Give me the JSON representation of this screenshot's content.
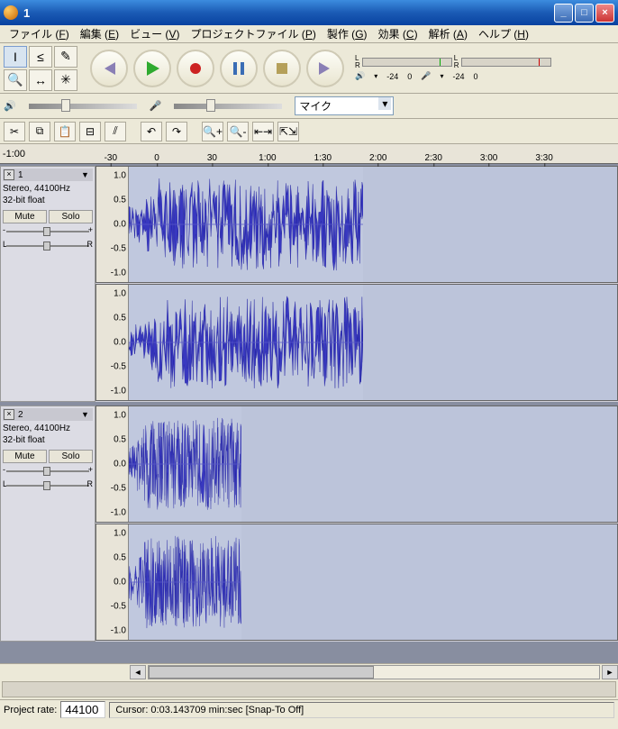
{
  "window": {
    "title": "1"
  },
  "menu": {
    "file": "ファイル",
    "file_key": "F",
    "edit": "編集",
    "edit_key": "E",
    "view": "ビュー",
    "view_key": "V",
    "project": "プロジェクトファイル",
    "project_key": "P",
    "generate": "製作",
    "generate_key": "G",
    "effect": "効果",
    "effect_key": "C",
    "analyze": "解析",
    "analyze_key": "A",
    "help": "ヘルプ",
    "help_key": "H"
  },
  "meters": {
    "left_label": "L",
    "right_label": "R",
    "ticks": [
      "-24",
      "0"
    ]
  },
  "toolbar2": {
    "input_device": "マイク"
  },
  "ruler": {
    "ticks": [
      "-1:00",
      "-30",
      "0",
      "30",
      "1:00",
      "1:30",
      "2:00",
      "2:30",
      "3:00",
      "3:30"
    ]
  },
  "tracks": {
    "t1": {
      "name": "1",
      "info1": "Stereo, 44100Hz",
      "info2": "32-bit float",
      "mute": "Mute",
      "solo": "Solo",
      "gain_minus": "-",
      "gain_plus": "+",
      "pan_l": "L",
      "pan_r": "R",
      "clip_start_pct": 0,
      "clip_width_pct": 48
    },
    "t2": {
      "name": "2",
      "info1": "Stereo, 44100Hz",
      "info2": "32-bit float",
      "mute": "Mute",
      "solo": "Solo",
      "gain_minus": "-",
      "gain_plus": "+",
      "pan_l": "L",
      "pan_r": "R",
      "clip_start_pct": 0,
      "clip_width_pct": 23
    }
  },
  "vscale": {
    "v1": "1.0",
    "v05": "0.5",
    "v0": "0.0",
    "vn05": "-0.5",
    "vn1": "-1.0"
  },
  "status": {
    "rate_label": "Project rate:",
    "rate_value": "44100",
    "cursor": "Cursor: 0:03.143709 min:sec  [Snap-To Off]"
  }
}
